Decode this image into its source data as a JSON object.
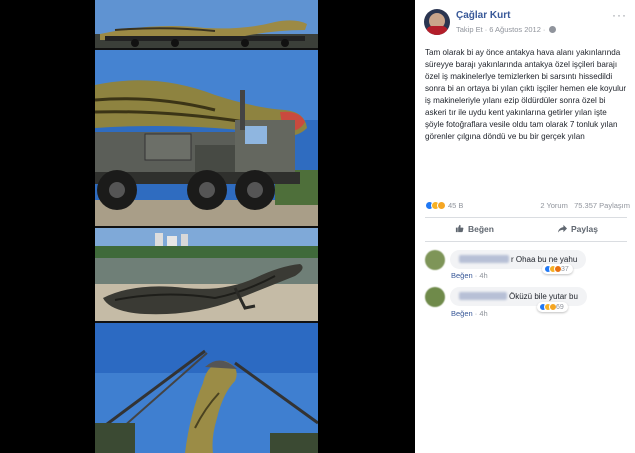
{
  "post": {
    "author": "Çağlar Kurt",
    "follow_label": "Takip Et",
    "date": "6 Ağustos 2012",
    "more_glyph": "···",
    "text": "Tam olarak bi ay önce antakya hava alanı yakınlarında süreyye barajı yakınlarında antakya özel işçileri barajı özel iş makinelerlye temizlerken bi sarsıntı hissedildi sonra bi an ortaya bi yılan çıktı işçiler hemen ele koyulur iş makineleriyle yılanı ezip öldürdüler sonra özel bi askeri tır ile uydu kent yakınlarına getirler yılan işte şöyle fotoğraflara vesile oldu tam olarak 7 tonluk yılan görenler çılgına döndü ve bu bir gerçek yılan",
    "reactions_count": "45 B",
    "comments_count": "2 Yorum",
    "shares_count": "75.357 Paylaşım",
    "like_label": "Beğen",
    "share_label": "Paylaş"
  },
  "comments": [
    {
      "text": "r Ohaa bu ne yahu",
      "like_label": "Beğen",
      "time": "4h",
      "reaction_count": "37"
    },
    {
      "text": "Öküzü bile yutar bu",
      "like_label": "Beğen",
      "time": "4h",
      "reaction_count": "69"
    }
  ],
  "colors": {
    "link": "#385898",
    "meta": "#90949c",
    "text": "#1d2129",
    "like": "#2078f4",
    "sky": "#4a86c8"
  }
}
